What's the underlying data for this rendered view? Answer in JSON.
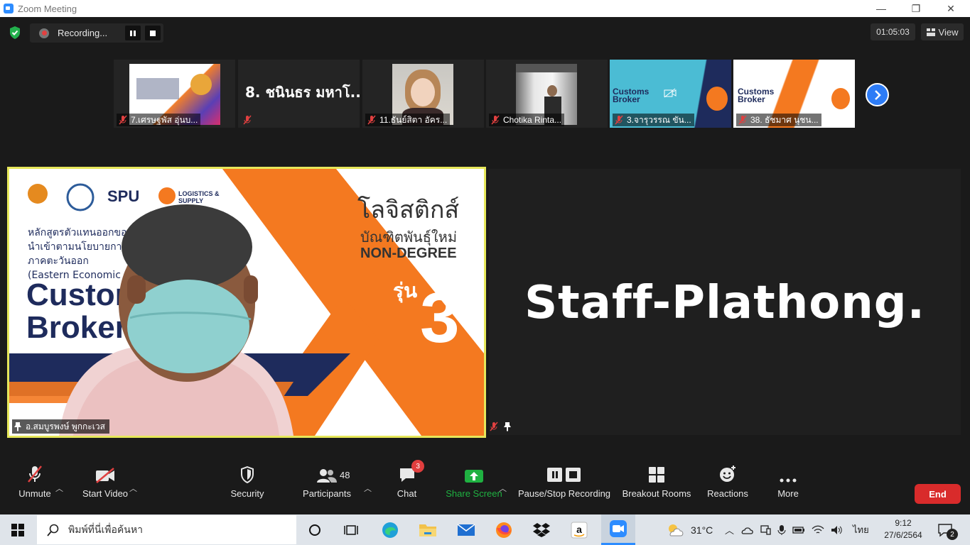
{
  "window": {
    "title": "Zoom Meeting",
    "minimize": "—",
    "maximize": "❐",
    "close": "✕"
  },
  "recording": {
    "label": "Recording..."
  },
  "timer": "01:05:03",
  "view_label": "View",
  "thumbnails": [
    {
      "name": "7.เศรษฐพัส อุ่นบ..."
    },
    {
      "name": "",
      "big_name": "8. ชนินธร มหาโ..."
    },
    {
      "name": "11.ธันย์สิตา อัคร..."
    },
    {
      "name": "Chotika Rinta..."
    },
    {
      "name": "3.จารุวรรณ ขัน..."
    },
    {
      "name": "38. ธัชมาศ นุชน..."
    }
  ],
  "speaker": {
    "name": "อ.สมบูรพงษ์ พูกกะเวส",
    "slide": {
      "logo_text": "SPU",
      "logistics": "LOGISTICS & SUPPLY CHAIN",
      "th_line1": "หลักสูตรตัวแทนออกของเพื่",
      "th_line2": "นำเข้าตามนโยบายการพัฒน",
      "th_line3": "ภาคตะวันออก",
      "en_line": "(Eastern Economic Cor",
      "big1": "Custom",
      "big2": "Broker",
      "title_th": "โลจิสติกส์",
      "sub_th": "บัณฑิตพันธุ์ใหม่",
      "non_degree": "NON-DEGREE",
      "run": "รุ่น",
      "num": "3"
    }
  },
  "staff": {
    "name": "Staff-Plathong."
  },
  "toolbar": {
    "unmute": "Unmute",
    "start_video": "Start Video",
    "security": "Security",
    "participants": "Participants",
    "participants_count": "48",
    "chat": "Chat",
    "chat_badge": "3",
    "share_screen": "Share Screen",
    "pause_stop": "Pause/Stop Recording",
    "breakout": "Breakout Rooms",
    "reactions": "Reactions",
    "more": "More",
    "end": "End"
  },
  "taskbar": {
    "search_placeholder": "พิมพ์ที่นี่เพื่อค้นหา",
    "weather": "31°C",
    "lang": "ไทย",
    "time": "9:12",
    "date": "27/6/2564",
    "notif_count": "2"
  },
  "colors": {
    "zoom_blue": "#2d8cff",
    "share_green": "#1fb141",
    "end_red": "#d92b2b",
    "speaker_border": "#e6e75a",
    "slide_orange": "#f47920",
    "slide_navy": "#1e2b5c"
  }
}
